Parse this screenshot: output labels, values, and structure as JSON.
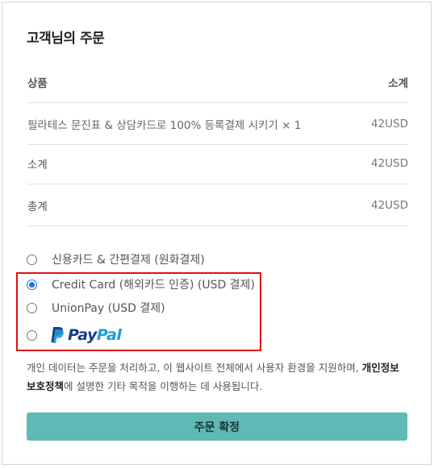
{
  "order": {
    "title": "고객님의 주문",
    "header": {
      "product": "상품",
      "subtotal": "소계"
    },
    "item": {
      "name": "필라테스 문진표 & 상담카드로 100% 등록결제 시키기",
      "qty": "× 1",
      "price": "42USD"
    },
    "subtotal": {
      "label": "소계",
      "value": "42USD"
    },
    "total": {
      "label": "총계",
      "value": "42USD"
    }
  },
  "payment": {
    "options": [
      {
        "label": "신용카드 & 간편결제 (원화결제)",
        "checked": false
      },
      {
        "label": "Credit Card (해외카드 인증) (USD 결제)",
        "checked": true
      },
      {
        "label": "UnionPay (USD 결제)",
        "checked": false
      },
      {
        "label": "PayPal",
        "checked": false,
        "logo": {
          "pay": "Pay",
          "pal": "Pal"
        }
      }
    ],
    "highlight_color": "#e01010",
    "accent": "#1a73e8"
  },
  "privacy": {
    "text_before": "개인 데이터는 주문을 처리하고, 이 웹사이트 전체에서 사용자 환경을 지원하며, ",
    "link": "개인정보 보호정책",
    "text_after": "에 설명한 기타 목적을 이행하는 데 사용됩니다."
  },
  "confirm": {
    "label": "주문 확정",
    "color": "#5fb9b5"
  }
}
